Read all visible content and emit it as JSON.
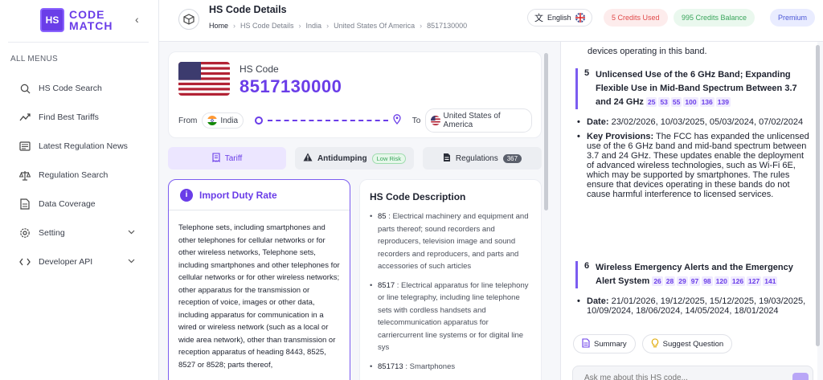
{
  "sidebar": {
    "logo_badge": "HS",
    "logo_line1": "CODE",
    "logo_line2": "MATCH",
    "menu_title": "ALL MENUS",
    "items": [
      {
        "label": "HS Code Search"
      },
      {
        "label": "Find Best Tariffs"
      },
      {
        "label": "Latest Regulation News"
      },
      {
        "label": "Regulation Search"
      },
      {
        "label": "Data Coverage"
      },
      {
        "label": "Setting"
      },
      {
        "label": "Developer API"
      }
    ]
  },
  "header": {
    "title": "HS Code Details",
    "breadcrumb": [
      "Home",
      "HS Code Details",
      "India",
      "United States Of America",
      "8517130000"
    ],
    "language": "English",
    "credits_used": "5 Credits Used",
    "credits_balance": "995 Credits Balance",
    "plan": "Premium"
  },
  "hs_card": {
    "label": "HS Code",
    "code": "8517130000",
    "from_label": "From",
    "from_country": "India",
    "to_label": "To",
    "to_country": "United States of America"
  },
  "tabs": {
    "tariff": "Tariff",
    "antidumping": "Antidumping",
    "antidumping_badge": "Low Risk",
    "regulations": "Regulations",
    "regulations_count": "367"
  },
  "duty": {
    "title": "Import Duty Rate",
    "text": "Telephone sets, including smartphones and other telephones for cellular networks or for other wireless networks, Telephone sets, including smartphones and other telephones for cellular networks or for other wireless networks; other apparatus for the transmission or reception of voice, images or other data, including apparatus for communication in a wired or wireless network (such as a local or wide area network), other than transmission or reception apparatus of heading 8443, 8525, 8527 or 8528; parts thereof,"
  },
  "description": {
    "title": "HS Code Description",
    "items": [
      {
        "code": "85",
        "text": " : Electrical machinery and equipment and parts thereof; sound recorders and reproducers, television image and sound recorders and reproducers, and parts and accessories of such articles"
      },
      {
        "code": "8517",
        "text": " : Electrical apparatus for line telephony or line telegraphy, including line telephone sets with cordless handsets and telecommunication apparatus for carriercurrent line systems or for digital line sys"
      },
      {
        "code": "851713",
        "text": " : Smartphones"
      }
    ]
  },
  "right_panel": {
    "top_text": "devices operating in this band.",
    "section5": {
      "num": "5",
      "title": "Unlicensed Use of the 6 GHz Band; Expanding Flexible Use in Mid-Band Spectrum Between 3.7 and 24 GHz",
      "refs": [
        "25",
        "53",
        "55",
        "100",
        "136",
        "139"
      ],
      "date_label": "Date:",
      "date": " 23/02/2026, 10/03/2025, 05/03/2024, 07/02/2024",
      "prov_label": "Key Provisions:",
      "prov": " The FCC has expanded the unlicensed use of the 6 GHz band and mid-band spectrum between 3.7 and 24 GHz. These updates enable the deployment of advanced wireless technologies, such as Wi-Fi 6E, which may be supported by smartphones. The rules ensure that devices operating in these bands do not cause harmful interference to licensed services."
    },
    "section6": {
      "num": "6",
      "title": "Wireless Emergency Alerts and the Emergency Alert System",
      "refs": [
        "26",
        "28",
        "29",
        "97",
        "98",
        "120",
        "126",
        "127",
        "141"
      ],
      "date_label": "Date:",
      "date": " 21/01/2026, 19/12/2025, 15/12/2025, 19/03/2025, 10/09/2024, 18/06/2024, 14/05/2024, 18/01/2024"
    },
    "summary_label": "Summary",
    "suggest_label": "Suggest Question",
    "ask_placeholder": "Ask me about this HS code..."
  }
}
